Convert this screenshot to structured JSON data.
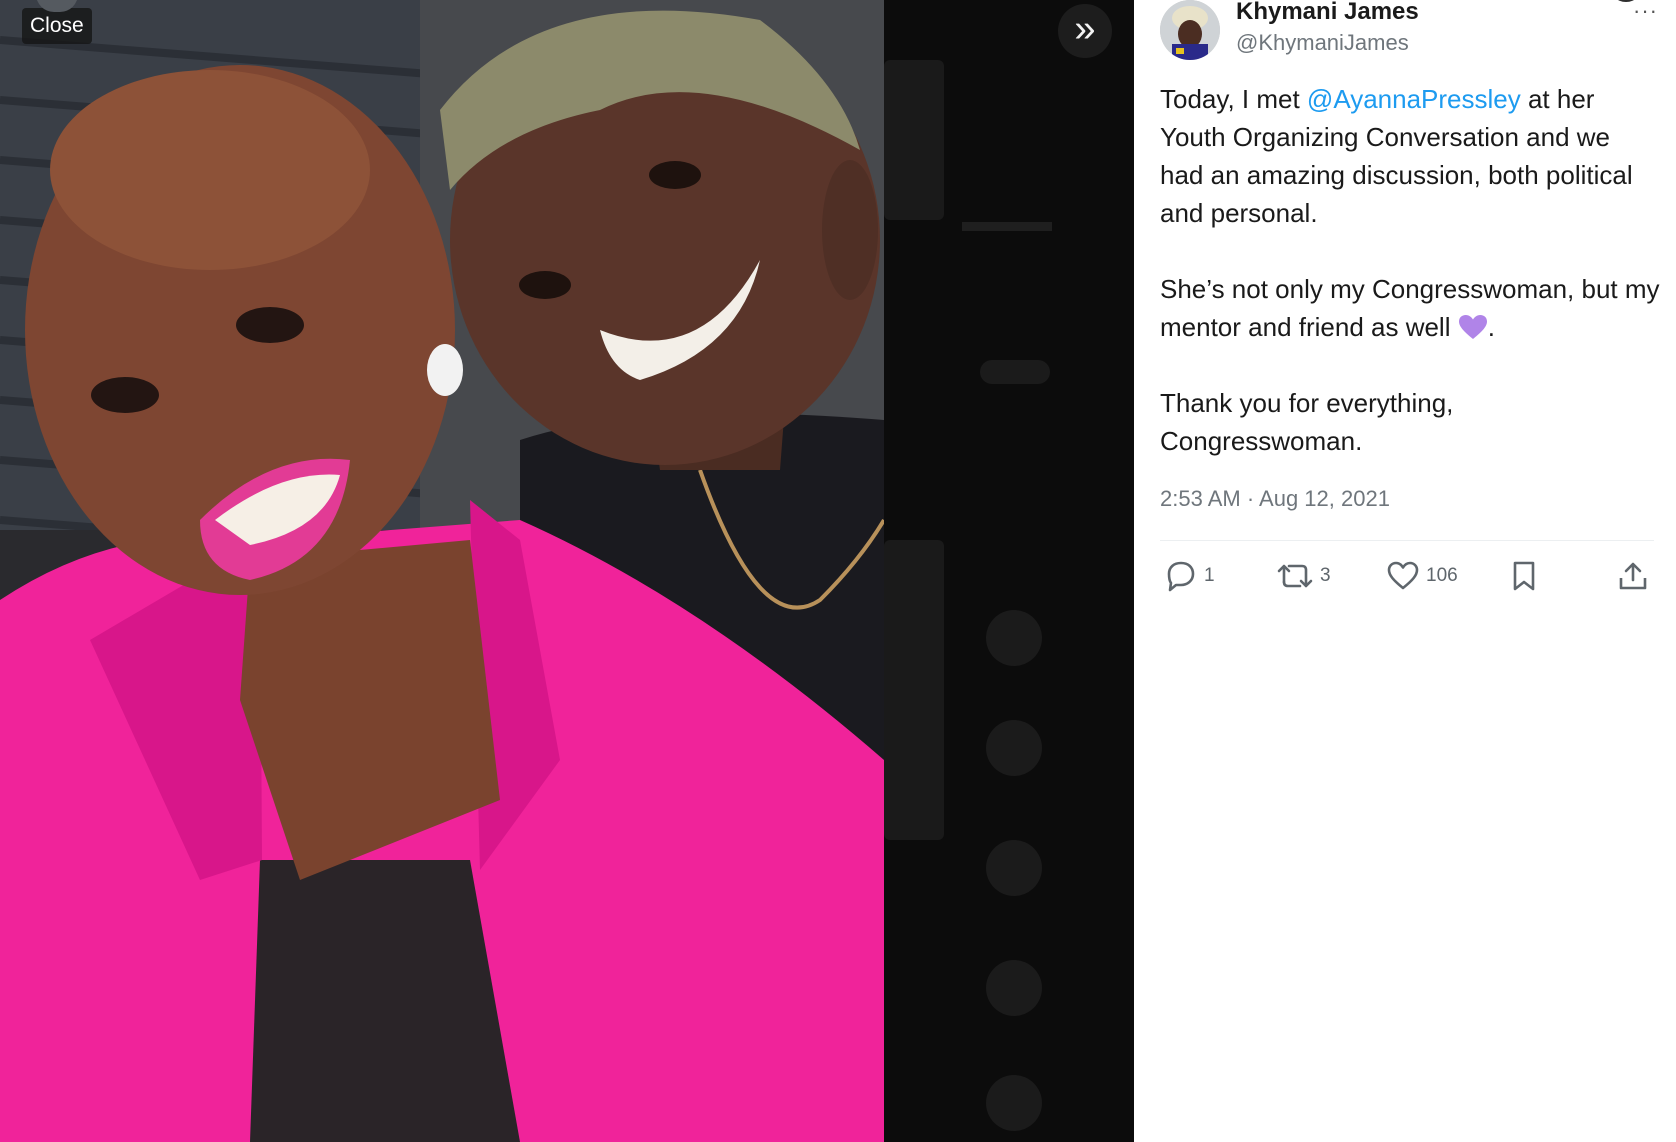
{
  "viewer": {
    "close_label": "Close",
    "expand_icon": "double-chevron-right-icon"
  },
  "tweet": {
    "author": {
      "name": "Khymani James",
      "handle": "@KhymaniJames"
    },
    "more_label": "···",
    "body": {
      "p1_before": "Today, I met ",
      "mention": "@AyannaPressley",
      "p1_after": " at her Youth Organizing Conversation and we had an amazing discussion, both political and personal.",
      "p2_before": "She’s not only my Congresswoman, but my mentor and friend as well ",
      "p2_after": ".",
      "p3": "Thank you for everything, Congresswoman."
    },
    "timestamp": "2:53 AM · Aug 12, 2021",
    "stats": {
      "replies": "1",
      "retweets": "3",
      "likes": "106"
    },
    "colors": {
      "mention": "#1d9bf0",
      "heart_emoji": "#b084e8"
    }
  }
}
